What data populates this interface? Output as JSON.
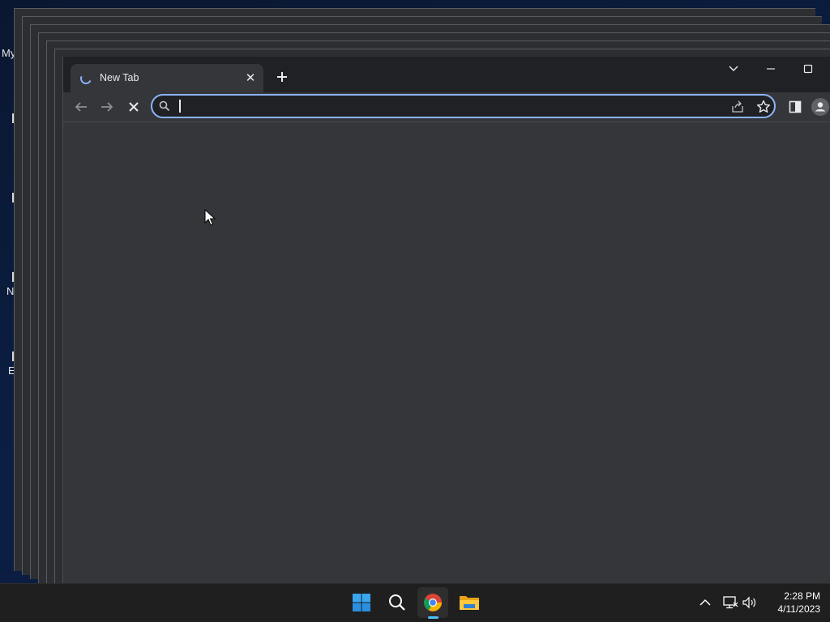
{
  "desktop": {
    "labels": [
      "My",
      "N",
      "E"
    ]
  },
  "browser": {
    "tab": {
      "title": "New Tab",
      "close_glyph": "✕",
      "loading": true
    },
    "newtab_glyph": "+",
    "window_controls": [
      "tab-search-icon",
      "minimize-icon",
      "maximize-icon"
    ],
    "toolbar": {
      "back_icon": "arrow-left-icon",
      "forward_icon": "arrow-right-icon",
      "stop_icon": "close-icon"
    },
    "omnibox": {
      "value": "",
      "placeholder": ""
    },
    "accent": "#8ab4f8"
  },
  "taskbar": {
    "apps": [
      "windows-start-icon",
      "search-icon",
      "chrome-icon",
      "file-explorer-icon"
    ],
    "active_app": "chrome-icon",
    "tray": [
      "chevron-up-icon",
      "network-icon",
      "volume-icon"
    ],
    "time": "2:28 PM",
    "date": "4/11/2023"
  }
}
